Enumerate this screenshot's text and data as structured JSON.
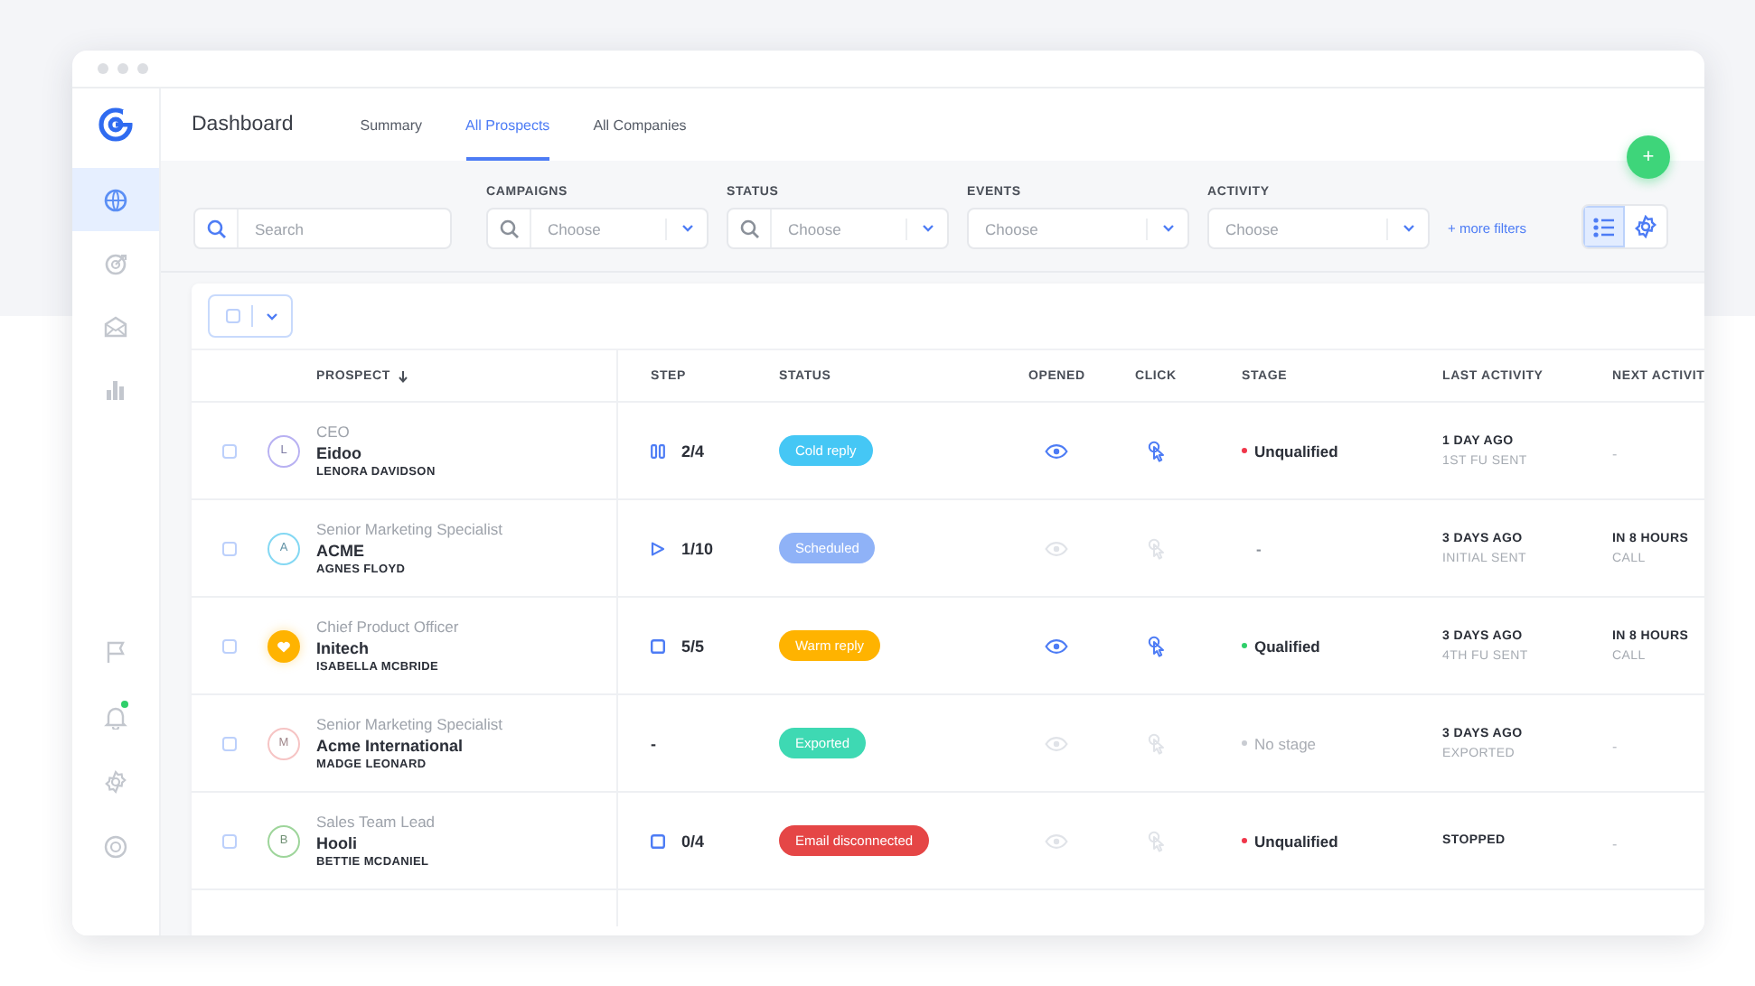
{
  "sidebar": {
    "items": [
      {
        "kind": "globe",
        "selected": true,
        "notification": false
      },
      {
        "kind": "target",
        "selected": false,
        "notification": false
      },
      {
        "kind": "mail",
        "selected": false,
        "notification": false
      },
      {
        "kind": "chart",
        "selected": false,
        "notification": false
      },
      {
        "kind": "flag",
        "selected": false,
        "notification": false
      },
      {
        "kind": "bell",
        "selected": false,
        "notification": true
      },
      {
        "kind": "gear",
        "selected": false,
        "notification": false
      },
      {
        "kind": "help",
        "selected": false,
        "notification": false
      }
    ]
  },
  "header": {
    "title": "Dashboard",
    "tabs": [
      {
        "label": "Summary",
        "selected": false
      },
      {
        "label": "All Prospects",
        "selected": true
      },
      {
        "label": "All Companies",
        "selected": false
      }
    ]
  },
  "add_button": {
    "label": "+"
  },
  "filters": {
    "search": {
      "placeholder": "Search"
    },
    "dropdowns": [
      {
        "label": "CAMPAIGNS",
        "placeholder": "Choose",
        "searchable": true
      },
      {
        "label": "STATUS",
        "placeholder": "Choose",
        "searchable": true
      },
      {
        "label": "EVENTS",
        "placeholder": "Choose",
        "searchable": false
      },
      {
        "label": "ACTIVITY",
        "placeholder": "Choose",
        "searchable": false
      }
    ],
    "more_filters": "+ more filters",
    "view_toggle": [
      {
        "kind": "list",
        "selected": true
      },
      {
        "kind": "settings",
        "selected": false
      }
    ]
  },
  "table": {
    "bulk_select": {
      "checked": false
    },
    "columns": [
      {
        "label": "PROSPECT",
        "sorted": true
      },
      {
        "label": "STEP",
        "sorted": false
      },
      {
        "label": "STATUS",
        "sorted": false
      },
      {
        "label": "OPENED",
        "sorted": false
      },
      {
        "label": "CLICK",
        "sorted": false
      },
      {
        "label": "STAGE",
        "sorted": false
      },
      {
        "label": "LAST ACTIVITY",
        "sorted": false
      },
      {
        "label": "NEXT ACTIVIT",
        "sorted": false
      }
    ],
    "rows": [
      {
        "checked": false,
        "avatar": {
          "kind": "letter",
          "text": "L",
          "color": "#b8b1f2"
        },
        "title": "CEO",
        "company": "Eidoo",
        "name": "LENORA DAVIDSON",
        "step": {
          "kind": "pause",
          "text": "2/4"
        },
        "status": {
          "text": "Cold reply",
          "color": "#45c7f5"
        },
        "opened": true,
        "clicked": true,
        "stage": {
          "kind": "set",
          "text": "Unqualified",
          "color": "#f0364a"
        },
        "last_activity": {
          "primary": "1 DAY AGO",
          "secondary": "1ST FU SENT"
        },
        "next_activity": {
          "text": "-"
        }
      },
      {
        "checked": false,
        "avatar": {
          "kind": "letter",
          "text": "A",
          "color": "#84d8f3"
        },
        "title": "Senior Marketing Specialist",
        "company": "ACME",
        "name": "AGNES FLOYD",
        "step": {
          "kind": "play",
          "text": "1/10"
        },
        "status": {
          "text": "Scheduled",
          "color": "#8fb2f7"
        },
        "opened": false,
        "clicked": false,
        "stage": {
          "kind": "empty",
          "text": "-"
        },
        "last_activity": {
          "primary": "3 DAYS AGO",
          "secondary": "INITIAL SENT"
        },
        "next_activity": {
          "primary": "IN 8 HOURS",
          "secondary": "CALL"
        }
      },
      {
        "checked": false,
        "avatar": {
          "kind": "heart",
          "color": "#ffb300"
        },
        "title": "Chief Product Officer",
        "company": "Initech",
        "name": "ISABELLA MCBRIDE",
        "step": {
          "kind": "stop",
          "text": "5/5"
        },
        "status": {
          "text": "Warm reply",
          "color": "#ffb300"
        },
        "opened": true,
        "clicked": true,
        "stage": {
          "kind": "set",
          "text": "Qualified",
          "color": "#2fcf6a"
        },
        "last_activity": {
          "primary": "3 DAYS AGO",
          "secondary": "4TH FU SENT"
        },
        "next_activity": {
          "primary": "IN 8 HOURS",
          "secondary": "CALL"
        }
      },
      {
        "checked": false,
        "avatar": {
          "kind": "letter",
          "text": "M",
          "color": "#f6c4c4"
        },
        "title": "Senior Marketing Specialist",
        "company": "Acme International",
        "name": "MADGE LEONARD",
        "step": {
          "kind": "none",
          "text": "-"
        },
        "status": {
          "text": "Exported",
          "color": "#3ed9b3"
        },
        "opened": false,
        "clicked": false,
        "stage": {
          "kind": "none",
          "text": "No stage",
          "color": "#c9ccd2"
        },
        "last_activity": {
          "primary": "3 DAYS AGO",
          "secondary": "EXPORTED"
        },
        "next_activity": {
          "text": "-"
        }
      },
      {
        "checked": false,
        "avatar": {
          "kind": "letter",
          "text": "B",
          "color": "#9ed59b"
        },
        "title": "Sales Team Lead",
        "company": "Hooli",
        "name": "BETTIE MCDANIEL",
        "step": {
          "kind": "stop",
          "text": "0/4"
        },
        "status": {
          "text": "Email disconnected",
          "color": "#e54646"
        },
        "opened": false,
        "clicked": false,
        "stage": {
          "kind": "set",
          "text": "Unqualified",
          "color": "#f0364a"
        },
        "last_activity": {
          "primary": "STOPPED"
        },
        "next_activity": {
          "text": "-"
        }
      }
    ]
  }
}
